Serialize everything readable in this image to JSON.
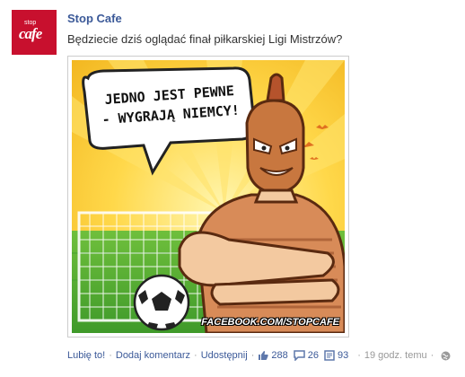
{
  "post": {
    "author": "Stop Cafe",
    "avatar_text_top": "stop",
    "avatar_text_main": "cafe",
    "message": "Będziecie dziś oglądać finał piłkarskiej Ligi Mistrzów?",
    "image": {
      "bubble_line1": "JEDNO JEST PEWNE",
      "bubble_line2": "- WYGRAJĄ NIEMCY!",
      "watermark": "FACEBOOK.COM/STOPCAFE"
    },
    "actions": {
      "like": "Lubię to!",
      "comment": "Dodaj komentarz",
      "share": "Udostępnij",
      "like_count": "288",
      "comment_count": "26",
      "share_count": "93",
      "time": "19 godz. temu"
    }
  },
  "colors": {
    "link": "#3b5998",
    "brand": "#c8102e"
  }
}
